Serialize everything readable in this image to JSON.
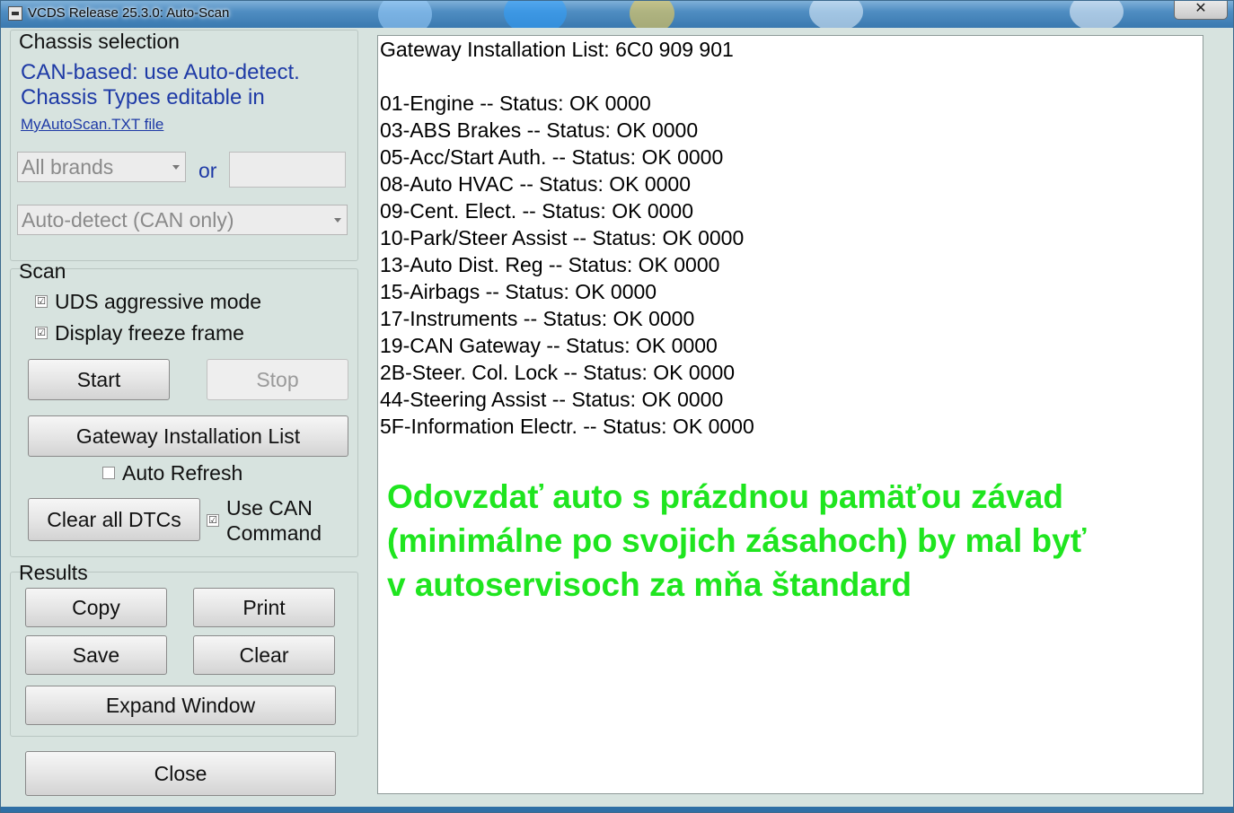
{
  "window": {
    "title": "VCDS Release 25.3.0:  Auto-Scan",
    "close_label": "✕"
  },
  "chassis": {
    "label": "Chassis selection",
    "info_line1": "CAN-based: use Auto-detect.",
    "info_line2": "Chassis Types editable in",
    "link": "MyAutoScan.TXT file",
    "brand_select": "All brands",
    "or_label": "or",
    "type_select": "Auto-detect (CAN only)"
  },
  "scan": {
    "label": "Scan",
    "uds_label": "UDS aggressive mode",
    "uds_checked": "☑",
    "freeze_label": "Display freeze frame",
    "freeze_checked": "☑",
    "start_label": "Start",
    "stop_label": "Stop",
    "gateway_label": "Gateway Installation List",
    "auto_refresh_label": "Auto Refresh",
    "clear_dtcs_label": "Clear all DTCs",
    "use_can_label1": "Use CAN",
    "use_can_label2": "Command",
    "use_can_checked": "☑"
  },
  "results": {
    "label": "Results",
    "copy_label": "Copy",
    "print_label": "Print",
    "save_label": "Save",
    "clear_label": "Clear",
    "expand_label": "Expand Window",
    "close_label": "Close"
  },
  "output": {
    "header": "Gateway Installation List:  6C0 909 901",
    "lines": [
      "01-Engine -- Status: OK 0000",
      "03-ABS Brakes -- Status: OK 0000",
      "05-Acc/Start Auth. -- Status: OK 0000",
      "08-Auto HVAC -- Status: OK 0000",
      "09-Cent. Elect. -- Status: OK 0000",
      "10-Park/Steer Assist -- Status: OK 0000",
      "13-Auto Dist. Reg -- Status: OK 0000",
      "15-Airbags -- Status: OK 0000",
      "17-Instruments -- Status: OK 0000",
      "19-CAN Gateway -- Status: OK 0000",
      "2B-Steer. Col. Lock -- Status: OK 0000",
      "44-Steering Assist -- Status: OK 0000",
      "5F-Information Electr. -- Status: OK 0000"
    ],
    "note_lines": [
      "Odovzdať auto s prázdnou pamäťou závad",
      "(minimálne po svojich zásahoch) by mal byť",
      "v autoservisoch za mňa štandard"
    ],
    "note_color": "#1fe51f"
  },
  "colors": {
    "link_blue": "#1e3aa6",
    "window_bg": "#d7e3df"
  }
}
